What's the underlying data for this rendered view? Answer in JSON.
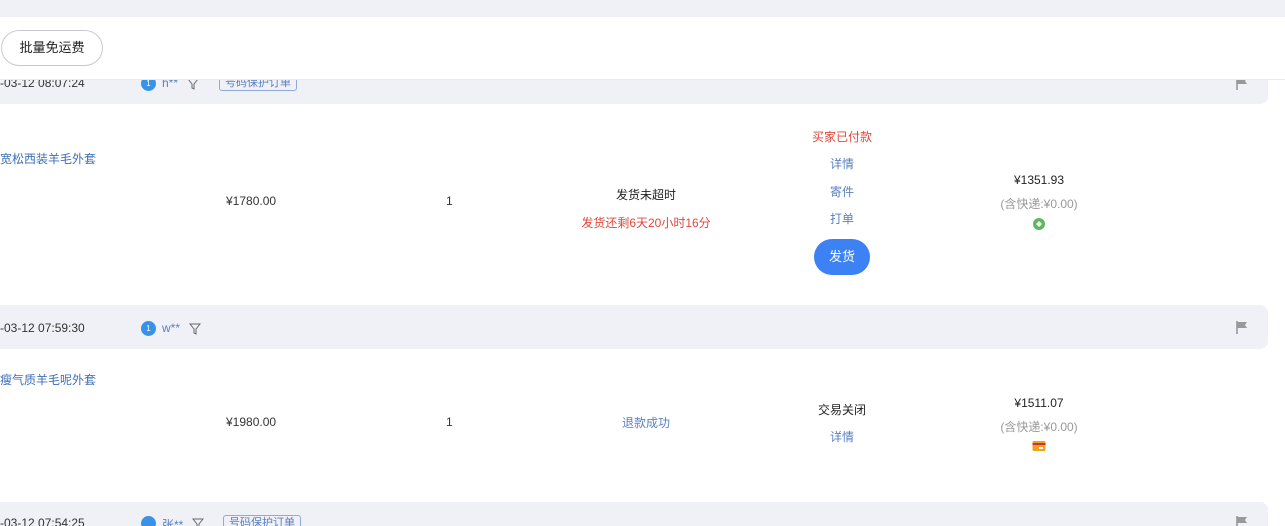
{
  "toolbar": {
    "batch_free_shipping_label": "批量免运费"
  },
  "orders": [
    {
      "time": "-03-12 08:07:24",
      "buyer": "h**",
      "buyer_badge": "1",
      "tag": "号码保护订单",
      "product": "宽松西装羊毛外套",
      "price": "¥1780.00",
      "qty": "1",
      "ship_status": "发货未超时",
      "ship_countdown": "发货还剩6天20小时16分",
      "trade_status": "买家已付款",
      "actions": [
        "详情",
        "寄件",
        "打单"
      ],
      "ship_button": "发货",
      "total": "¥1351.93",
      "shipping_note": "(含快递:¥0.00)",
      "pay_icon": "green-pay-icon"
    },
    {
      "time": "-03-12 07:59:30",
      "buyer": "w**",
      "buyer_badge": "1",
      "product": "瘦气质羊毛呢外套",
      "price": "¥1980.00",
      "qty": "1",
      "refund_status": "退款成功",
      "trade_status": "交易关闭",
      "actions": [
        "详情"
      ],
      "total": "¥1511.07",
      "shipping_note": "(含快递:¥0.00)",
      "pay_icon": "card-pay-icon"
    },
    {
      "time": "-03-12 07:54:25",
      "buyer": "张**",
      "tag": "号码保护订单"
    }
  ],
  "colors": {
    "accent": "#3c82f5",
    "link": "#5a7fc0",
    "warning": "#e0473a",
    "row_header_bg": "#f0f1f6"
  }
}
